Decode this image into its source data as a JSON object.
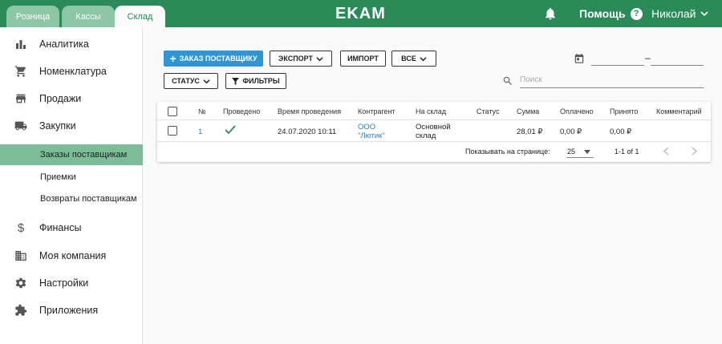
{
  "header": {
    "tabs": [
      {
        "label": "Розница"
      },
      {
        "label": "Кассы"
      },
      {
        "label": "Склад"
      }
    ],
    "logo": "EKAM",
    "help_label": "Помощь",
    "help_icon": "?",
    "user_name": "Николай"
  },
  "sidebar": {
    "items": [
      {
        "label": "Аналитика",
        "icon": "bar-chart-icon"
      },
      {
        "label": "Номенклатура",
        "icon": "cart-icon"
      },
      {
        "label": "Продажи",
        "icon": "store-icon"
      },
      {
        "label": "Закупки",
        "icon": "truck-icon"
      }
    ],
    "subitems": [
      {
        "label": "Заказы поставщикам"
      },
      {
        "label": "Приемки"
      },
      {
        "label": "Возвраты поставщикам"
      }
    ],
    "bottom_items": [
      {
        "label": "Финансы",
        "icon": "dollar-icon"
      },
      {
        "label": "Моя компания",
        "icon": "building-icon"
      },
      {
        "label": "Настройки",
        "icon": "gear-icon"
      },
      {
        "label": "Приложения",
        "icon": "puzzle-icon"
      }
    ]
  },
  "toolbar": {
    "order_label": "ЗАКАЗ ПОСТАВЩИКУ",
    "export_label": "ЭКСПОРТ",
    "import_label": "ИМПОРТ",
    "all_label": "ВСЕ",
    "status_label": "СТАТУС",
    "filters_label": "ФИЛЬТРЫ",
    "date_separator": "–",
    "search_placeholder": "Поиск"
  },
  "table": {
    "columns": [
      "№",
      "Проведено",
      "Время проведения",
      "Контрагент",
      "На склад",
      "Статус",
      "Сумма",
      "Оплачено",
      "Принято",
      "Комментарий"
    ],
    "rows": [
      {
        "num": "1",
        "posted": true,
        "time": "24.07.2020 10:11",
        "counterparty_line1": "ООО",
        "counterparty_line2": "\"Лютик\"",
        "warehouse_line1": "Основной",
        "warehouse_line2": "склад",
        "status": "",
        "sum": "28,01 ₽",
        "paid": "0,00 ₽",
        "accepted": "0,00 ₽",
        "comment": ""
      }
    ],
    "footer": {
      "per_page_label": "Показывать на странице:",
      "per_page_value": "25",
      "range": "1-1 of 1"
    }
  },
  "colors": {
    "brand_green": "#2a8b58",
    "active_sub": "#7bbd96",
    "primary_blue": "#2f96d6"
  }
}
